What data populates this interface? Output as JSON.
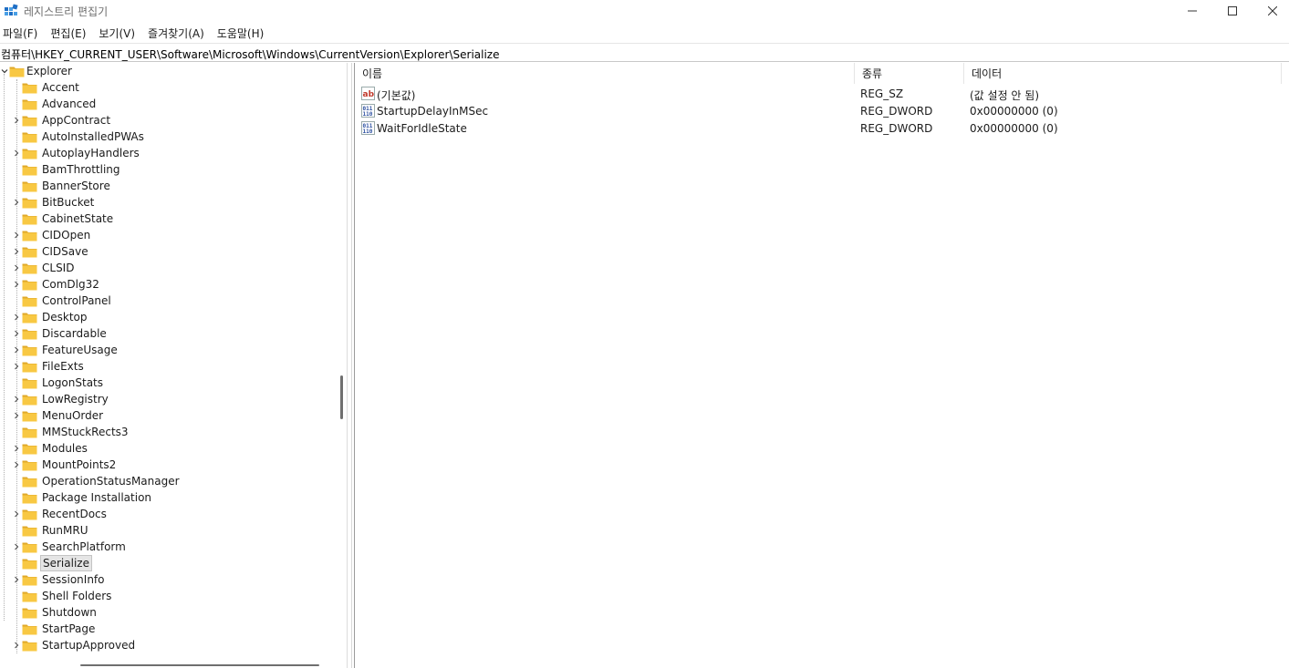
{
  "window": {
    "title": "레지스트리 편집기",
    "icon": "registry-editor-icon"
  },
  "menu": [
    {
      "label": "파일(F)"
    },
    {
      "label": "편집(E)"
    },
    {
      "label": "보기(V)"
    },
    {
      "label": "즐겨찾기(A)"
    },
    {
      "label": "도움말(H)"
    }
  ],
  "address": {
    "path": "컴퓨터\\HKEY_CURRENT_USER\\Software\\Microsoft\\Windows\\CurrentVersion\\Explorer\\Serialize"
  },
  "tree": {
    "parent": "Explorer",
    "selected": "Serialize",
    "items": [
      {
        "label": "Accent",
        "expandable": false
      },
      {
        "label": "Advanced",
        "expandable": false
      },
      {
        "label": "AppContract",
        "expandable": true
      },
      {
        "label": "AutoInstalledPWAs",
        "expandable": false
      },
      {
        "label": "AutoplayHandlers",
        "expandable": true
      },
      {
        "label": "BamThrottling",
        "expandable": false
      },
      {
        "label": "BannerStore",
        "expandable": false
      },
      {
        "label": "BitBucket",
        "expandable": true
      },
      {
        "label": "CabinetState",
        "expandable": false
      },
      {
        "label": "CIDOpen",
        "expandable": true
      },
      {
        "label": "CIDSave",
        "expandable": true
      },
      {
        "label": "CLSID",
        "expandable": true
      },
      {
        "label": "ComDlg32",
        "expandable": true
      },
      {
        "label": "ControlPanel",
        "expandable": false
      },
      {
        "label": "Desktop",
        "expandable": true
      },
      {
        "label": "Discardable",
        "expandable": true
      },
      {
        "label": "FeatureUsage",
        "expandable": true
      },
      {
        "label": "FileExts",
        "expandable": true
      },
      {
        "label": "LogonStats",
        "expandable": false
      },
      {
        "label": "LowRegistry",
        "expandable": true
      },
      {
        "label": "MenuOrder",
        "expandable": true
      },
      {
        "label": "MMStuckRects3",
        "expandable": false
      },
      {
        "label": "Modules",
        "expandable": true
      },
      {
        "label": "MountPoints2",
        "expandable": true
      },
      {
        "label": "OperationStatusManager",
        "expandable": false
      },
      {
        "label": "Package Installation",
        "expandable": false
      },
      {
        "label": "RecentDocs",
        "expandable": true
      },
      {
        "label": "RunMRU",
        "expandable": false
      },
      {
        "label": "SearchPlatform",
        "expandable": true
      },
      {
        "label": "Serialize",
        "expandable": false
      },
      {
        "label": "SessionInfo",
        "expandable": true
      },
      {
        "label": "Shell Folders",
        "expandable": false
      },
      {
        "label": "Shutdown",
        "expandable": false
      },
      {
        "label": "StartPage",
        "expandable": false
      },
      {
        "label": "StartupApproved",
        "expandable": true
      }
    ]
  },
  "list": {
    "columns": {
      "name": "이름",
      "type": "종류",
      "data": "데이터"
    },
    "rows": [
      {
        "icon": "string-value-icon",
        "name": "(기본값)",
        "type": "REG_SZ",
        "data": "(값 설정 안 됨)"
      },
      {
        "icon": "binary-value-icon",
        "name": "StartupDelayInMSec",
        "type": "REG_DWORD",
        "data": "0x00000000 (0)"
      },
      {
        "icon": "binary-value-icon",
        "name": "WaitForIdleState",
        "type": "REG_DWORD",
        "data": "0x00000000 (0)"
      }
    ]
  },
  "colors": {
    "folder": "#f8c843",
    "folder_dark": "#e0a92a",
    "selection": "#e5e5e5",
    "string_icon": "#c0392b",
    "binary_icon": "#2b4fa0"
  }
}
